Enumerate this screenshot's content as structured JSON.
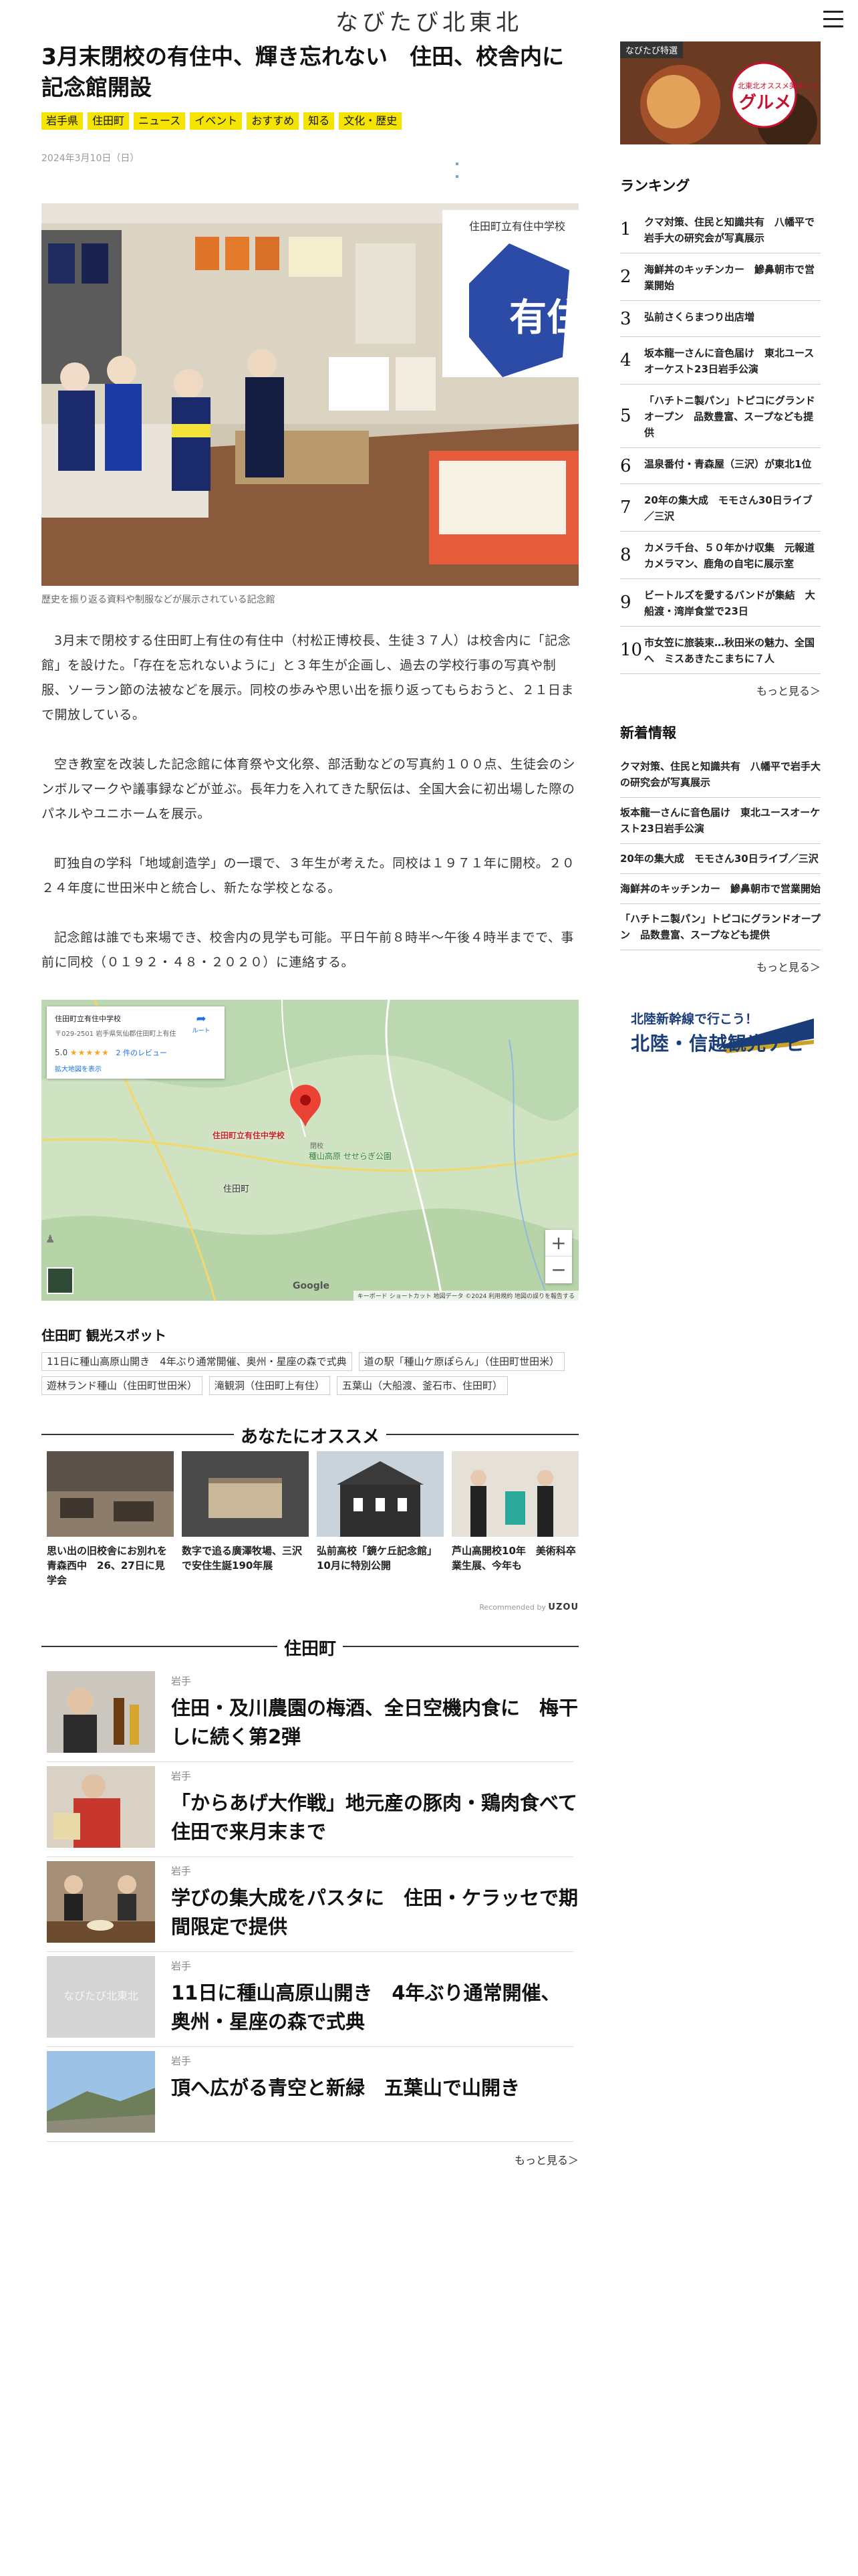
{
  "site": {
    "logo": "なびたび北東北"
  },
  "article": {
    "title": "3月末閉校の有住中、輝き忘れない　住田、校舎内に記念館開設",
    "tags": [
      "岩手県",
      "住田町",
      "ニュース",
      "イベント",
      "おすすめ",
      "知る",
      "文化・歴史"
    ],
    "date": "2024年3月10日（日）",
    "photo_caption": "歴史を振り返る資料や制服などが展示されている記念館",
    "photo_sign": "有住",
    "photo_board": "住田町立有住中学校",
    "paragraphs": [
      "3月末で閉校する住田町上有住の有住中（村松正博校長、生徒３７人）は校舎内に「記念館」を設けた。「存在を忘れないように」と３年生が企画し、過去の学校行事の写真や制服、ソーラン節の法被などを展示。同校の歩みや思い出を振り返ってもらおうと、２１日まで開放している。",
      "空き教室を改装した記念館に体育祭や文化祭、部活動などの写真約１００点、生徒会のシンボルマークや議事録などが並ぶ。長年力を入れてきた駅伝は、全国大会に初出場した際のパネルやユニホームを展示。",
      "町独自の学科「地域創造学」の一環で、３年生が考えた。同校は１９７１年に開校。２０２４年度に世田米中と統合し、新たな学校となる。",
      "記念館は誰でも来場でき、校舎内の見学も可能。平日午前８時半〜午後４時半までで、事前に同校（０１９２・４８・２０２０）に連絡する。"
    ]
  },
  "map": {
    "info_title": "住田町立有住中学校",
    "info_address": "〒029-2501 岩手県気仙郡住田町上有住",
    "info_rating": "5.0",
    "info_stars": "★★★★★",
    "info_reviews": "2 件のレビュー",
    "info_link": "拡大地図を表示",
    "directions": "ルート",
    "pin_label": "住田町立有住中学校",
    "pin_sub": "閉校",
    "town": "住田町",
    "park": "種山高原 せせらぎ公園",
    "google": "Google",
    "footer": "キーボード ショートカット  地図データ ©2024  利用規約  地図の誤りを報告する",
    "zoom_in": "+",
    "zoom_out": "−"
  },
  "spots": {
    "title": "住田町 観光スポット",
    "items": [
      "11日に種山高原山開き　4年ぶり通常開催、奥州・星座の森で式典",
      "道の駅「種山ケ原ぽらん」（住田町世田米）",
      "遊林ランド種山（住田町世田米）",
      "滝観洞（住田町上有住）",
      "五葉山（大船渡、釜石市、住田町）"
    ]
  },
  "recommend": {
    "title": "あなたにオススメ",
    "items": [
      {
        "text": "思い出の旧校舎にお別れを　青森西中　26、27日に見学会"
      },
      {
        "text": "数字で追る廣澤牧場、三沢で安住生誕190年展"
      },
      {
        "text": "弘前高校「鏡ケ丘記念館」10月に特別公開"
      },
      {
        "text": "芦山高開校10年　美術科卒業生展、今年も"
      }
    ],
    "credit_prefix": "Recommended by",
    "credit_brand": "UZOU"
  },
  "local": {
    "title": "住田町",
    "items": [
      {
        "pref": "岩手",
        "title": "住田・及川農園の梅酒、全日空機内食に　梅干しに続く第2弾"
      },
      {
        "pref": "岩手",
        "title": "「からあげ大作戦」地元産の豚肉・鶏肉食べて　住田で来月末まで"
      },
      {
        "pref": "岩手",
        "title": "学びの集大成をパスタに　住田・ケラッセで期間限定で提供"
      },
      {
        "pref": "岩手",
        "title": "11日に種山高原山開き　4年ぶり通常開催、奥州・星座の森で式典"
      },
      {
        "pref": "岩手",
        "title": "頂へ広がる青空と新緑　五葉山で山開き"
      }
    ],
    "placeholder_logo": "なびたび北東北",
    "more": "もっと見る＞"
  },
  "sidebar": {
    "banner_label": "なびたび特選",
    "banner_text": "グルメ",
    "banner_sub": "北東北オススメ美味ニュース",
    "ranking_title": "ランキング",
    "ranking": [
      {
        "num": "1",
        "text": "クマ対策、住民と知識共有　八幡平で岩手大の研究会が写真展示"
      },
      {
        "num": "2",
        "text": "海鮮丼のキッチンカー　鰺鼻朝市で営業開始"
      },
      {
        "num": "3",
        "text": "弘前さくらまつり出店増"
      },
      {
        "num": "4",
        "text": "坂本龍一さんに音色届け　東北ユースオーケスト23日岩手公演"
      },
      {
        "num": "5",
        "text": "「ハチトニ製パン」トピコにグランドオープン　品数豊富、スープなども提供"
      },
      {
        "num": "6",
        "text": "温泉番付・青森屋（三沢）が東北1位"
      },
      {
        "num": "7",
        "text": "20年の集大成　モモさん30日ライブ／三沢"
      },
      {
        "num": "8",
        "text": "カメラ千台、５０年かけ収集　元報道カメラマン、鹿角の自宅に展示室"
      },
      {
        "num": "9",
        "text": "ビートルズを愛するバンドが集結　大船渡・湾岸食堂で23日"
      },
      {
        "num": "10",
        "text": "市女笠に旅装束…秋田米の魅力、全国へ　ミスあきたこまちに７人"
      }
    ],
    "ranking_more": "もっと見る＞",
    "news_title": "新着情報",
    "news": [
      "クマ対策、住民と知識共有　八幡平で岩手大の研究会が写真展示",
      "坂本龍一さんに音色届け　東北ユースオーケスト23日岩手公演",
      "20年の集大成　モモさん30日ライブ／三沢",
      "海鮮丼のキッチンカー　鰺鼻朝市で営業開始",
      "「ハチトニ製パン」トピコにグランドオープン　品数豊富、スープなども提供"
    ],
    "news_more": "もっと見る＞",
    "banner2_top": "北陸新幹線で行こう！",
    "banner2_main": "北陸・信越観光ナビ"
  }
}
